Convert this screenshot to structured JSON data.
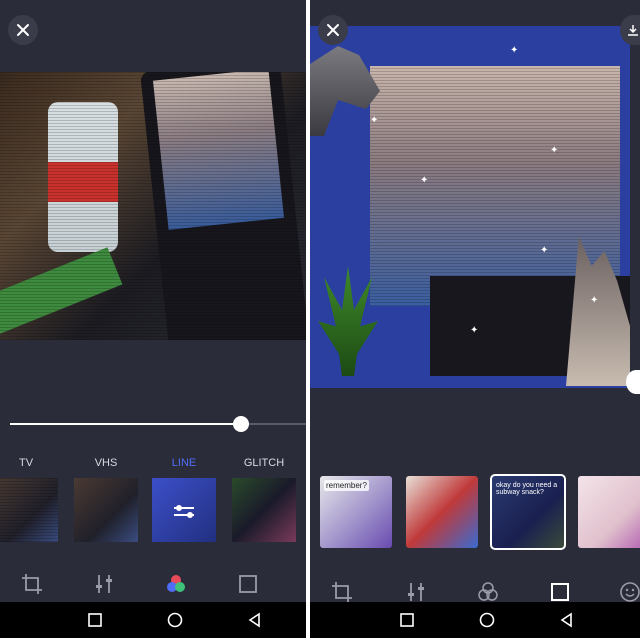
{
  "left_panel": {
    "filters": [
      {
        "name": "TV",
        "active": false
      },
      {
        "name": "VHS",
        "active": false
      },
      {
        "name": "LINE",
        "active": true
      },
      {
        "name": "GLITCH",
        "active": false
      }
    ],
    "intensity_fraction": 0.78,
    "toolbar": [
      "crop-icon",
      "adjust-sliders-icon",
      "effects-circles-icon",
      "frame-square-icon"
    ],
    "active_color": "#4f6df5"
  },
  "right_panel": {
    "sticker_thumbs": [
      {
        "label": "remember?"
      },
      {
        "label": ""
      },
      {
        "label": "okay do you need a subway snack?"
      },
      {
        "label": ""
      }
    ],
    "selected_sticker": 2,
    "toolbar": [
      "crop-icon",
      "adjust-sliders-icon",
      "effects-circles-icon",
      "frame-square-icon",
      "smiley-icon"
    ]
  },
  "navbar": [
    "recents-square-icon",
    "home-circle-icon",
    "back-triangle-icon"
  ]
}
